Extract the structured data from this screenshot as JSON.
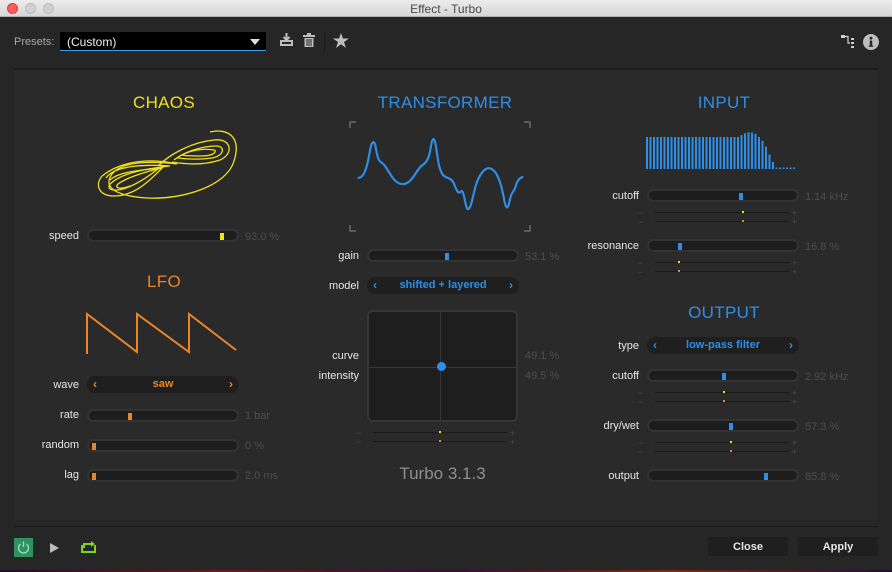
{
  "window": {
    "title": "Effect - Turbo"
  },
  "toolbar": {
    "presets_label": "Presets:",
    "preset_value": "(Custom)",
    "icons": [
      "save-preset-icon",
      "delete-icon",
      "favorite-star-icon",
      "routing-icon",
      "info-icon"
    ]
  },
  "colors": {
    "chaos": "#f1e11c",
    "lfo": "#ea8527",
    "accent_blue": "#2d8fe8",
    "power_green": "#2d9461",
    "loop_green": "#7ad61e"
  },
  "chaos": {
    "title": "CHAOS",
    "speed": {
      "label": "speed",
      "value_text": "93.0 %",
      "fraction": 0.93
    }
  },
  "lfo": {
    "title": "LFO",
    "wave": {
      "label": "wave",
      "value": "saw"
    },
    "rate": {
      "label": "rate",
      "value_text": "1 bar",
      "fraction": 0.26
    },
    "random": {
      "label": "random",
      "value_text": "0 %",
      "fraction": 0.0
    },
    "lag": {
      "label": "lag",
      "value_text": "2.0 ms",
      "fraction": 0.0
    }
  },
  "transformer": {
    "title": "TRANSFORMER",
    "gain": {
      "label": "gain",
      "value_text": "53.1 %",
      "fraction": 0.531
    },
    "model": {
      "label": "model",
      "value": "shifted + layered"
    },
    "curve": {
      "label": "curve",
      "value_text": "49.1 %",
      "fraction": 0.491
    },
    "intensity": {
      "label": "intensity",
      "value_text": "49.5 %",
      "fraction": 0.495
    },
    "mod_rows": [
      {
        "fraction": 0.49,
        "color": "#f1e11c"
      },
      {
        "fraction": 0.49,
        "color": "#ea8527"
      }
    ],
    "version": "Turbo 3.1.3"
  },
  "input": {
    "title": "INPUT",
    "spectrum": [
      1,
      1,
      1,
      1,
      1,
      1,
      1,
      1,
      1,
      1,
      1,
      1,
      1,
      1,
      1,
      1,
      1,
      1,
      1,
      1,
      1,
      1,
      1,
      1,
      1,
      1,
      1,
      1.06,
      1.12,
      1.15,
      1.14,
      1.1,
      1.0,
      0.88,
      0.7,
      0.45,
      0.22,
      0.03,
      0.03,
      0.03,
      0.03,
      0.03,
      0.03
    ],
    "cutoff": {
      "label": "cutoff",
      "value_text": "1.14 kHz",
      "fraction": 0.63,
      "mod_rows": [
        {
          "fraction": 0.65,
          "color": "#f1e11c"
        },
        {
          "fraction": 0.65,
          "color": "#ea8527"
        }
      ]
    },
    "resonance": {
      "label": "resonance",
      "value_text": "16.8 %",
      "fraction": 0.19,
      "mod_rows": [
        {
          "fraction": 0.17,
          "color": "#f1e11c"
        },
        {
          "fraction": 0.17,
          "color": "#ea8527"
        }
      ]
    }
  },
  "output": {
    "title": "OUTPUT",
    "type": {
      "label": "type",
      "value": "low-pass filter"
    },
    "cutoff": {
      "label": "cutoff",
      "value_text": "2.92 kHz",
      "fraction": 0.51,
      "mod_rows": [
        {
          "fraction": 0.51,
          "color": "#f1e11c"
        },
        {
          "fraction": 0.51,
          "color": "#ea8527"
        }
      ]
    },
    "drywet": {
      "label": "dry/wet",
      "value_text": "57.3 %",
      "fraction": 0.56,
      "mod_rows": [
        {
          "fraction": 0.56,
          "color": "#f1e11c"
        },
        {
          "fraction": 0.56,
          "color": "#ea8527"
        }
      ]
    },
    "output": {
      "label": "output",
      "value_text": "85.8 %",
      "fraction": 0.81
    }
  },
  "footer": {
    "close_label": "Close",
    "apply_label": "Apply"
  }
}
